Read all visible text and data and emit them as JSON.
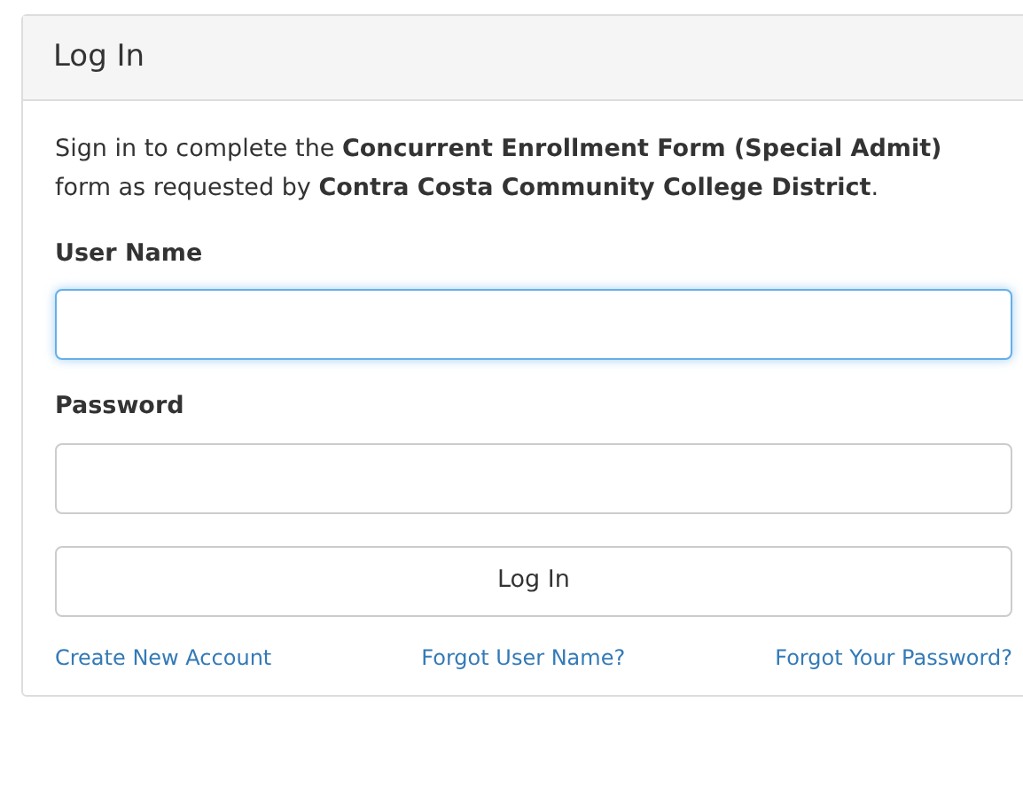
{
  "panel": {
    "title": "Log In"
  },
  "intro": "Sign in to complete the **Concurrent Enrollment Form (Special Admit)** form as requested by **Contra Costa Community College District**.",
  "fields": [
    {
      "label": "User Name",
      "focused": true
    },
    {
      "label": "Password",
      "focused": false
    }
  ],
  "submit": "Log In",
  "links": [
    "Create New Account",
    "Forgot User Name?",
    "Forgot Your Password?"
  ]
}
